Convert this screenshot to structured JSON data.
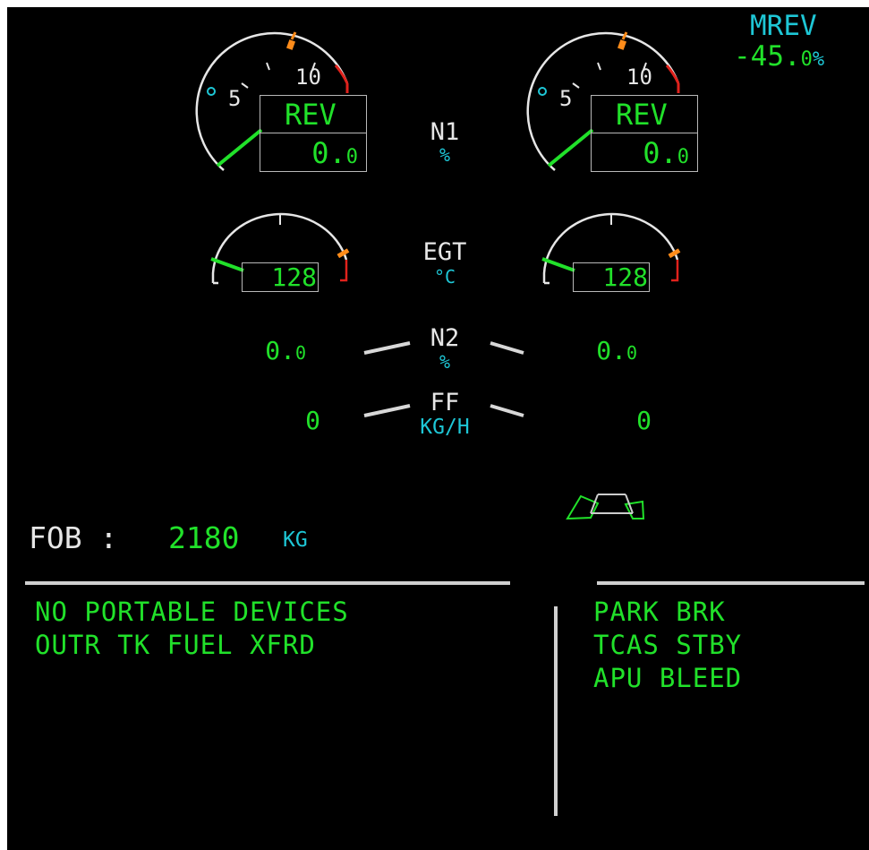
{
  "mode": {
    "label": "MREV",
    "value": "-45.",
    "decimal": "0",
    "unit": "%"
  },
  "n1": {
    "label": "N1",
    "unit": "%",
    "left": {
      "scale_5": "5",
      "scale_10": "10",
      "mode": "REV",
      "value": "0.",
      "decimal": "0"
    },
    "right": {
      "scale_5": "5",
      "scale_10": "10",
      "mode": "REV",
      "value": "0.",
      "decimal": "0"
    }
  },
  "egt": {
    "label": "EGT",
    "unit": "°C",
    "left": {
      "value": "128"
    },
    "right": {
      "value": "128"
    }
  },
  "n2": {
    "label": "N2",
    "unit": "%",
    "left": {
      "value": "0.",
      "decimal": "0"
    },
    "right": {
      "value": "0.",
      "decimal": "0"
    }
  },
  "ff": {
    "label": "FF",
    "unit": "KG/H",
    "left": {
      "value": "0"
    },
    "right": {
      "value": "0"
    }
  },
  "fob": {
    "label": "FOB :",
    "value": "2180",
    "unit": "KG"
  },
  "memo_left": [
    "NO PORTABLE DEVICES",
    "OUTR TK FUEL XFRD"
  ],
  "memo_right": [
    "PARK BRK",
    "TCAS STBY",
    "APU BLEED"
  ],
  "colors": {
    "green": "#21e12a",
    "cyan": "#1ec7d6",
    "amber": "#ff8c1a",
    "red": "#e0221c",
    "white": "#e6e6e6",
    "background": "#000000"
  }
}
